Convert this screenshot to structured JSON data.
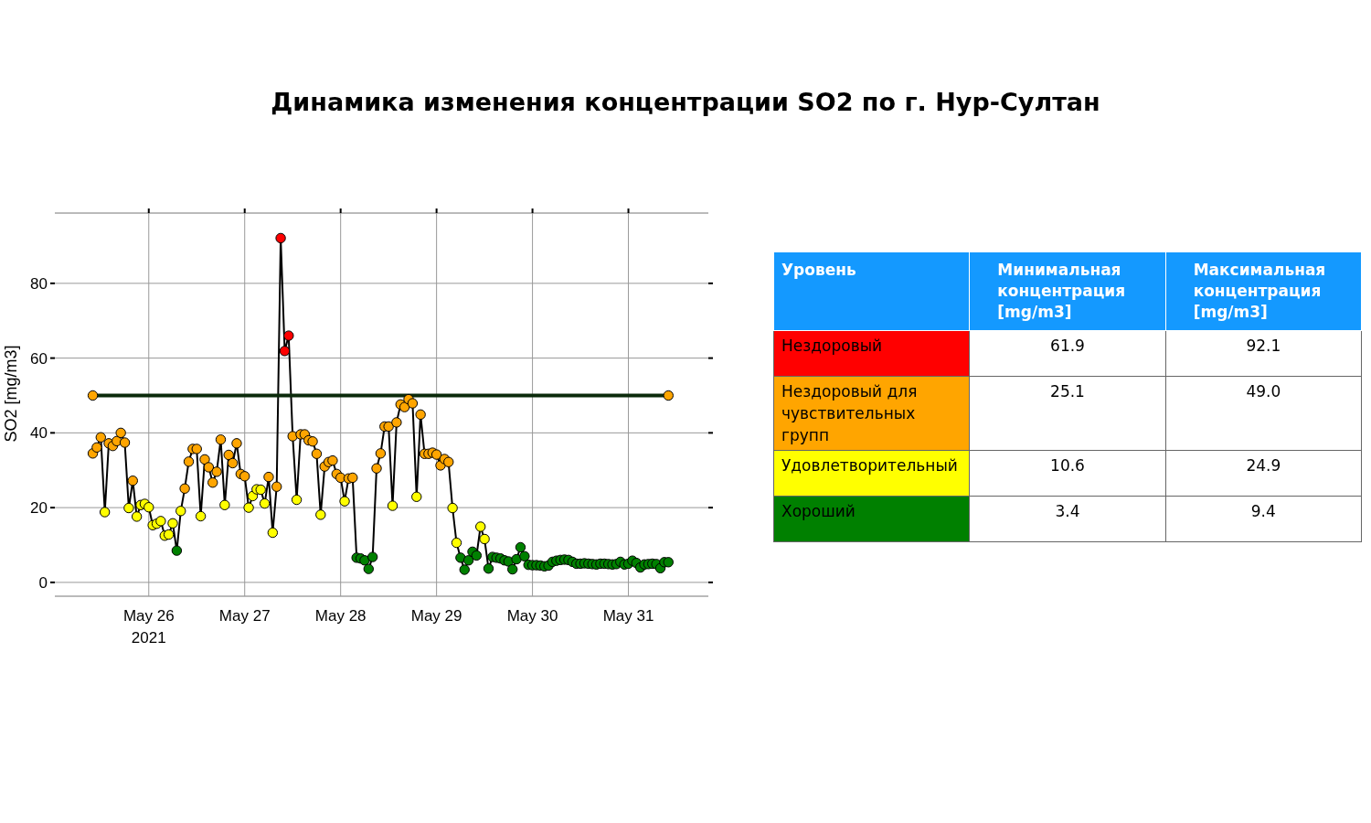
{
  "title": "Динамика изменения концентрации SO2 по г. Нур-Султан",
  "chart": {
    "chart_data": {
      "type": "line",
      "grid": true,
      "ylabel": "SO2 [mg/m3]",
      "annotations": [
        "2021"
      ],
      "xlim": [
        "2021-05-25 00:30",
        "2021-05-31 20:00"
      ],
      "ylim": [
        -3.7,
        98.8
      ],
      "xticks": [
        {
          "value": "2021-05-26 00:00",
          "label": "May 26"
        },
        {
          "value": "2021-05-27 00:00",
          "label": "May 27"
        },
        {
          "value": "2021-05-28 00:00",
          "label": "May 28"
        },
        {
          "value": "2021-05-29 00:00",
          "label": "May 29"
        },
        {
          "value": "2021-05-30 00:00",
          "label": "May 30"
        },
        {
          "value": "2021-05-31 00:00",
          "label": "May 31"
        }
      ],
      "yticks": [
        0,
        20,
        40,
        60,
        80
      ],
      "series": [
        {
          "color": "#000000",
          "marker": true,
          "x": [
            "2021-05-25 10:00",
            "2021-05-25 11:00",
            "2021-05-25 12:00",
            "2021-05-25 13:00",
            "2021-05-25 14:00",
            "2021-05-25 15:00",
            "2021-05-25 16:00",
            "2021-05-25 17:00",
            "2021-05-25 18:00",
            "2021-05-25 19:00",
            "2021-05-25 20:00",
            "2021-05-25 21:00",
            "2021-05-25 22:00",
            "2021-05-25 23:00",
            "2021-05-26 00:00",
            "2021-05-26 01:00",
            "2021-05-26 02:00",
            "2021-05-26 03:00",
            "2021-05-26 04:00",
            "2021-05-26 05:00",
            "2021-05-26 06:00",
            "2021-05-26 07:00",
            "2021-05-26 08:00",
            "2021-05-26 09:00",
            "2021-05-26 10:00",
            "2021-05-26 11:00",
            "2021-05-26 12:00",
            "2021-05-26 13:00",
            "2021-05-26 14:00",
            "2021-05-26 15:00",
            "2021-05-26 16:00",
            "2021-05-26 17:00",
            "2021-05-26 18:00",
            "2021-05-26 19:00",
            "2021-05-26 20:00",
            "2021-05-26 21:00",
            "2021-05-26 22:00",
            "2021-05-26 23:00",
            "2021-05-27 00:00",
            "2021-05-27 01:00",
            "2021-05-27 02:00",
            "2021-05-27 03:00",
            "2021-05-27 04:00",
            "2021-05-27 05:00",
            "2021-05-27 06:00",
            "2021-05-27 07:00",
            "2021-05-27 08:00",
            "2021-05-27 09:00",
            "2021-05-27 10:00",
            "2021-05-27 11:00",
            "2021-05-27 12:00",
            "2021-05-27 13:00",
            "2021-05-27 14:00",
            "2021-05-27 15:00",
            "2021-05-27 16:00",
            "2021-05-27 17:00",
            "2021-05-27 18:00",
            "2021-05-27 19:00",
            "2021-05-27 20:00",
            "2021-05-27 21:00",
            "2021-05-27 22:00",
            "2021-05-27 23:00",
            "2021-05-28 00:00",
            "2021-05-28 01:00",
            "2021-05-28 02:00",
            "2021-05-28 03:00",
            "2021-05-28 04:00",
            "2021-05-28 05:00",
            "2021-05-28 06:00",
            "2021-05-28 07:00",
            "2021-05-28 08:00",
            "2021-05-28 09:00",
            "2021-05-28 10:00",
            "2021-05-28 11:00",
            "2021-05-28 12:00",
            "2021-05-28 13:00",
            "2021-05-28 14:00",
            "2021-05-28 15:00",
            "2021-05-28 16:00",
            "2021-05-28 17:00",
            "2021-05-28 18:00",
            "2021-05-28 19:00",
            "2021-05-28 20:00",
            "2021-05-28 21:00",
            "2021-05-28 22:00",
            "2021-05-28 23:00",
            "2021-05-29 00:00",
            "2021-05-29 01:00",
            "2021-05-29 02:00",
            "2021-05-29 03:00",
            "2021-05-29 04:00",
            "2021-05-29 05:00",
            "2021-05-29 06:00",
            "2021-05-29 07:00",
            "2021-05-29 08:00",
            "2021-05-29 09:00",
            "2021-05-29 10:00",
            "2021-05-29 11:00",
            "2021-05-29 12:00",
            "2021-05-29 13:00",
            "2021-05-29 14:00",
            "2021-05-29 15:00",
            "2021-05-29 16:00",
            "2021-05-29 17:00",
            "2021-05-29 18:00",
            "2021-05-29 19:00",
            "2021-05-29 20:00",
            "2021-05-29 21:00",
            "2021-05-29 22:00",
            "2021-05-29 23:00",
            "2021-05-30 00:00",
            "2021-05-30 01:00",
            "2021-05-30 02:00",
            "2021-05-30 03:00",
            "2021-05-30 04:00",
            "2021-05-30 05:00",
            "2021-05-30 06:00",
            "2021-05-30 07:00",
            "2021-05-30 08:00",
            "2021-05-30 09:00",
            "2021-05-30 10:00",
            "2021-05-30 11:00",
            "2021-05-30 12:00",
            "2021-05-30 13:00",
            "2021-05-30 14:00",
            "2021-05-30 15:00",
            "2021-05-30 16:00",
            "2021-05-30 17:00",
            "2021-05-30 18:00",
            "2021-05-30 19:00",
            "2021-05-30 20:00",
            "2021-05-30 21:00",
            "2021-05-30 22:00",
            "2021-05-30 23:00",
            "2021-05-31 00:00",
            "2021-05-31 01:00",
            "2021-05-31 02:00",
            "2021-05-31 03:00",
            "2021-05-31 04:00",
            "2021-05-31 05:00",
            "2021-05-31 06:00",
            "2021-05-31 07:00",
            "2021-05-31 08:00",
            "2021-05-31 09:00",
            "2021-05-31 10:00"
          ],
          "values": [
            34.5,
            36.1,
            38.8,
            18.8,
            37.2,
            36.5,
            37.8,
            40.0,
            37.4,
            19.9,
            27.2,
            17.6,
            20.7,
            21.0,
            20.1,
            15.3,
            15.7,
            16.4,
            12.5,
            12.8,
            15.8,
            8.5,
            19.1,
            25.1,
            32.3,
            35.7,
            35.7,
            17.7,
            32.9,
            30.8,
            26.7,
            29.6,
            38.2,
            20.7,
            34.1,
            31.9,
            37.2,
            29.0,
            28.4,
            20.0,
            23.1,
            24.9,
            24.8,
            21.1,
            28.2,
            13.3,
            25.6,
            92.1,
            61.9,
            66.0,
            39.1,
            22.1,
            39.6,
            39.6,
            38.0,
            37.7,
            34.4,
            18.1,
            31.0,
            32.2,
            32.6,
            29.0,
            28.0,
            21.7,
            27.8,
            28.0,
            6.6,
            6.4,
            5.9,
            3.6,
            6.8,
            30.5,
            34.5,
            41.7,
            41.7,
            20.5,
            42.8,
            47.6,
            46.9,
            49.0,
            47.9,
            22.9,
            44.9,
            34.4,
            34.4,
            34.7,
            34.2,
            31.3,
            33.0,
            32.2,
            19.9,
            10.6,
            6.6,
            3.4,
            5.9,
            8.2,
            7.2,
            14.9,
            11.6,
            3.7,
            6.8,
            6.6,
            6.4,
            5.9,
            5.6,
            3.5,
            6.2,
            9.4,
            7.0,
            4.7,
            4.6,
            4.6,
            4.5,
            4.3,
            4.5,
            5.5,
            5.8,
            6.0,
            6.1,
            6.0,
            5.5,
            5.0,
            5.0,
            5.1,
            5.0,
            4.9,
            4.8,
            5.0,
            5.0,
            4.9,
            4.8,
            4.9,
            5.5,
            4.8,
            5.0,
            5.8,
            5.2,
            4.0,
            4.8,
            4.9,
            5.0,
            4.9,
            3.8,
            5.4,
            5.4
          ]
        },
        {
          "color": "#0b2a0b",
          "marker": true,
          "x": [
            "2021-05-25 10:00",
            "2021-05-31 10:00"
          ],
          "values": [
            50,
            50
          ]
        }
      ]
    }
  },
  "table": {
    "columns": [
      "Уровень",
      "Минимальная  концентрация [mg/m3]",
      "Максимальная концентрация [mg/m3]"
    ],
    "rows": [
      {
        "level": "Нездоровый",
        "color": "#ff0000",
        "min": "61.9",
        "max": "92.1"
      },
      {
        "level": "Нездоровый для чувствительных групп",
        "color": "#ffa500",
        "min": "25.1",
        "max": "49.0"
      },
      {
        "level": "Удовлетворительный",
        "color": "#ffff00",
        "min": "10.6",
        "max": "24.9"
      },
      {
        "level": "Хороший",
        "color": "#008000",
        "min": "3.4",
        "max": "9.4"
      }
    ]
  }
}
